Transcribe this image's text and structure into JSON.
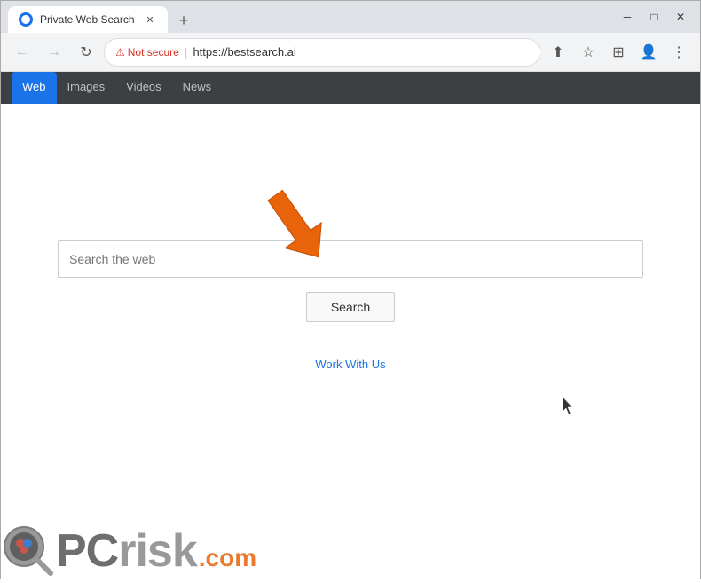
{
  "browser": {
    "tab_title": "Private Web Search",
    "new_tab_label": "+",
    "window_controls": {
      "minimize": "─",
      "maximize": "□",
      "close": "✕"
    }
  },
  "nav": {
    "back_label": "←",
    "forward_label": "→",
    "reload_label": "↻",
    "not_secure_label": "Not secure",
    "url": "https://bestsearch.ai",
    "address_separator": "|"
  },
  "search_tabs": [
    {
      "label": "Web",
      "active": true
    },
    {
      "label": "Images",
      "active": false
    },
    {
      "label": "Videos",
      "active": false
    },
    {
      "label": "News",
      "active": false
    }
  ],
  "main": {
    "search_placeholder": "Search the web",
    "search_button_label": "Search",
    "work_with_us_label": "Work With Us"
  },
  "watermark": {
    "pc_text": "PC",
    "risk_text": "risk",
    "dotcom_text": ".com"
  }
}
